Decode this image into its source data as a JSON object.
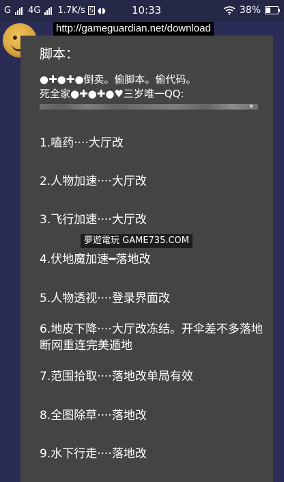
{
  "status_bar": {
    "carrier1": "G",
    "network": "4G",
    "speed": "1.7K/s",
    "sim_badge": "S",
    "time": "10:33",
    "battery": "38%",
    "battery_level": 0.38
  },
  "url_banner": "http://gameguardian.net/download",
  "dialog": {
    "title": "脚本：",
    "desc_line1": "●✚●✚●倒卖。偷脚本。偷代码。",
    "desc_line2": "死全家●✚●✚●♥三岁唯一QQ:",
    "items": [
      "1.嗑药····大厅改",
      "2.人物加速····大厅改",
      "3.飞行加速····大厅改",
      "4.伏地魔加速━落地改",
      "5.人物透视····登录界面改",
      "6.地皮下降····大厅改冻结。开伞差不多落地断网重连完美遁地",
      "7.范围拾取····落地改单局有效",
      "8.全图除草····落地改",
      "9.水下行走····落地改"
    ]
  },
  "watermark": "夢遊電玩 GAME735.COM"
}
